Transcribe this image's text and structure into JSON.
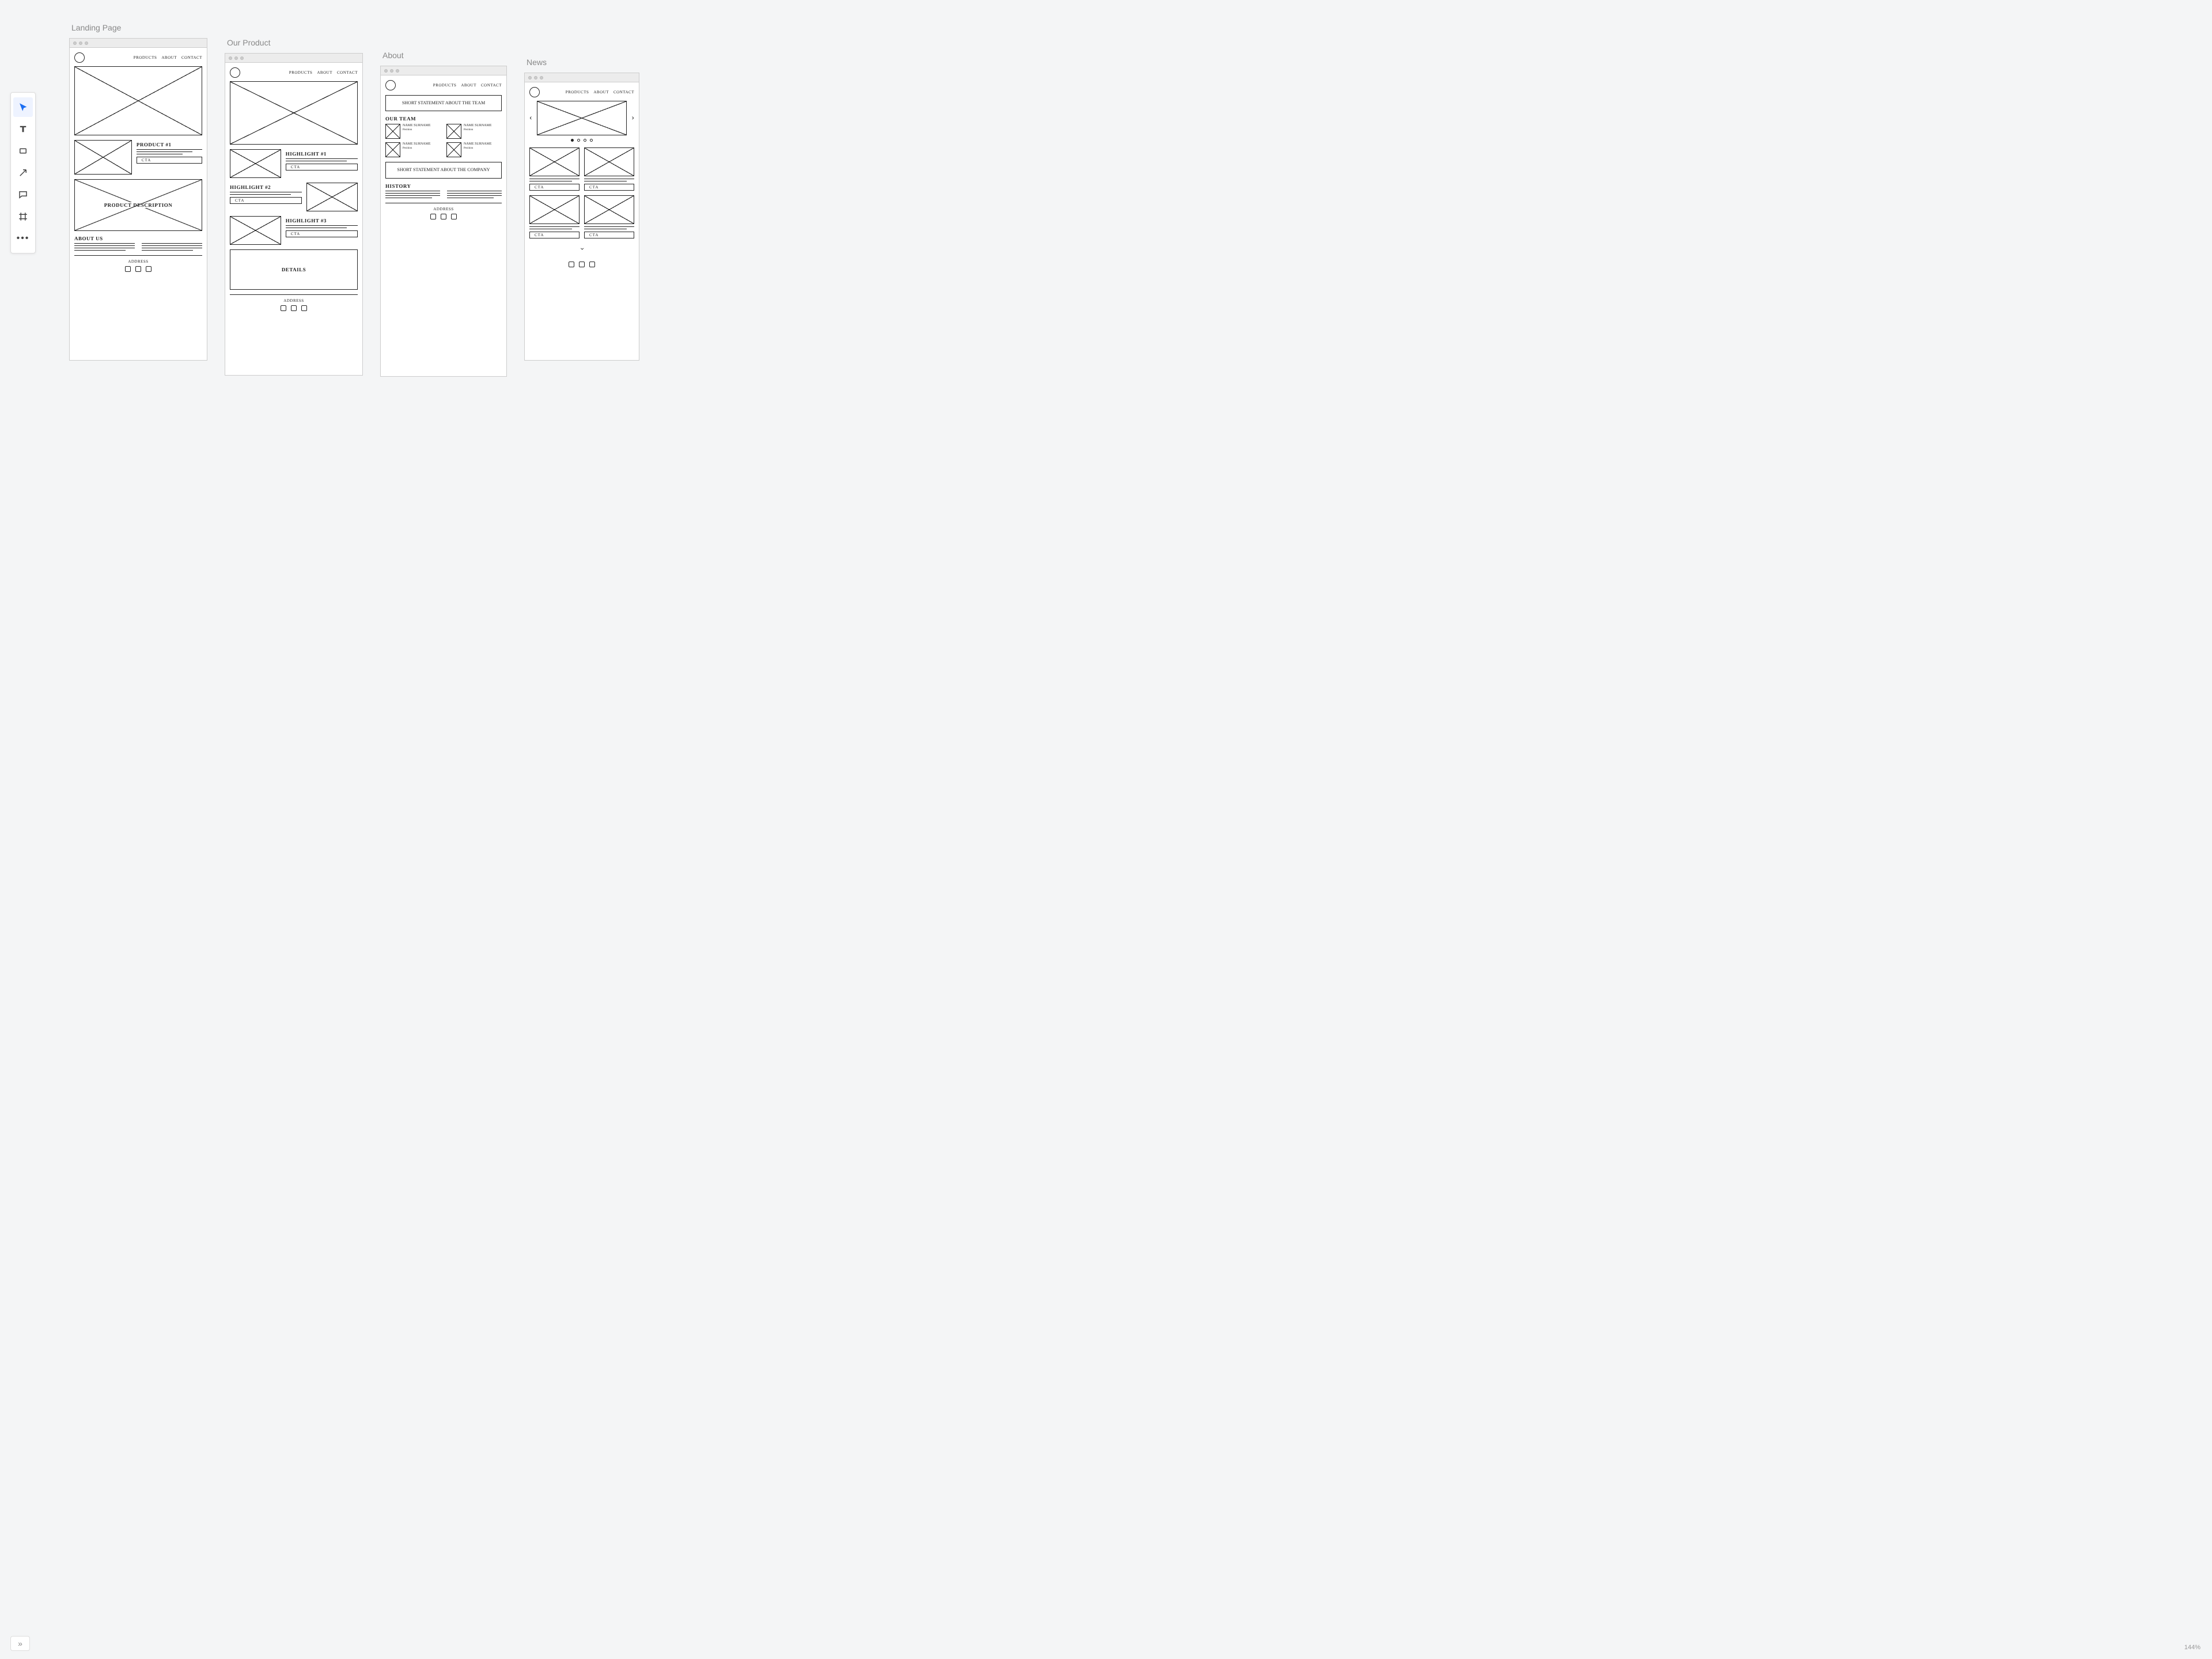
{
  "app": {
    "zoom_label": "144%"
  },
  "toolbox": {
    "tools": [
      {
        "name": "select",
        "selected": true
      },
      {
        "name": "text"
      },
      {
        "name": "shape"
      },
      {
        "name": "arrow"
      },
      {
        "name": "comment"
      },
      {
        "name": "frame"
      },
      {
        "name": "more"
      }
    ]
  },
  "nav": {
    "links": [
      "Products",
      "About",
      "Contact"
    ]
  },
  "boards": {
    "landing": {
      "title": "Landing Page",
      "product_label": "Product #1",
      "cta": "CTA",
      "product_desc_label": "Product Description",
      "about_us_label": "About Us",
      "footer_address": "Address"
    },
    "product": {
      "title": "Our Product",
      "h1": "Highlight #1",
      "h2": "Highlight #2",
      "h3": "Highlight #3",
      "cta": "CTA",
      "details": "Details",
      "footer_address": "Address"
    },
    "about": {
      "title": "About",
      "stmt_team": "Short statement about the team",
      "our_team": "Our Team",
      "member_name": "Name Surname",
      "member_position": "Position",
      "stmt_company": "Short statement about the company",
      "history": "History",
      "footer_address": "Address"
    },
    "news": {
      "title": "News",
      "cta": "CTA"
    }
  }
}
